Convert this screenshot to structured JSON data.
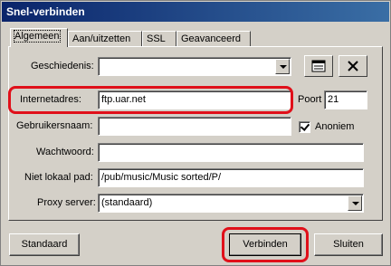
{
  "window": {
    "title": "Snel-verbinden"
  },
  "tabs": [
    {
      "label": "Algemeen",
      "active": true
    },
    {
      "label": "Aan/uitzetten",
      "active": false
    },
    {
      "label": "SSL",
      "active": false
    },
    {
      "label": "Geavanceerd",
      "active": false
    }
  ],
  "form": {
    "history_label": "Geschiedenis:",
    "history_value": "",
    "address_label": "Internetadres:",
    "address_value": "ftp.uar.net",
    "port_label": "Poort",
    "port_value": "21",
    "username_label": "Gebruikersnaam:",
    "username_value": "",
    "anonymous_label": "Anoniem",
    "anonymous_checked": true,
    "password_label": "Wachtwoord:",
    "password_value": "",
    "remote_path_label": "Niet lokaal pad:",
    "remote_path_value": "/pub/music/Music sorted/P/",
    "proxy_label": "Proxy server:",
    "proxy_value": "(standaard)"
  },
  "buttons": {
    "default_label": "Standaard",
    "connect_label": "Verbinden",
    "close_label": "Sluiten"
  },
  "icons": {
    "bookmarks": "address-book-icon",
    "delete": "delete-x-icon"
  },
  "colors": {
    "titlebar_start": "#0a246a",
    "titlebar_end": "#3a6ea5",
    "annotation": "#e0101a"
  }
}
